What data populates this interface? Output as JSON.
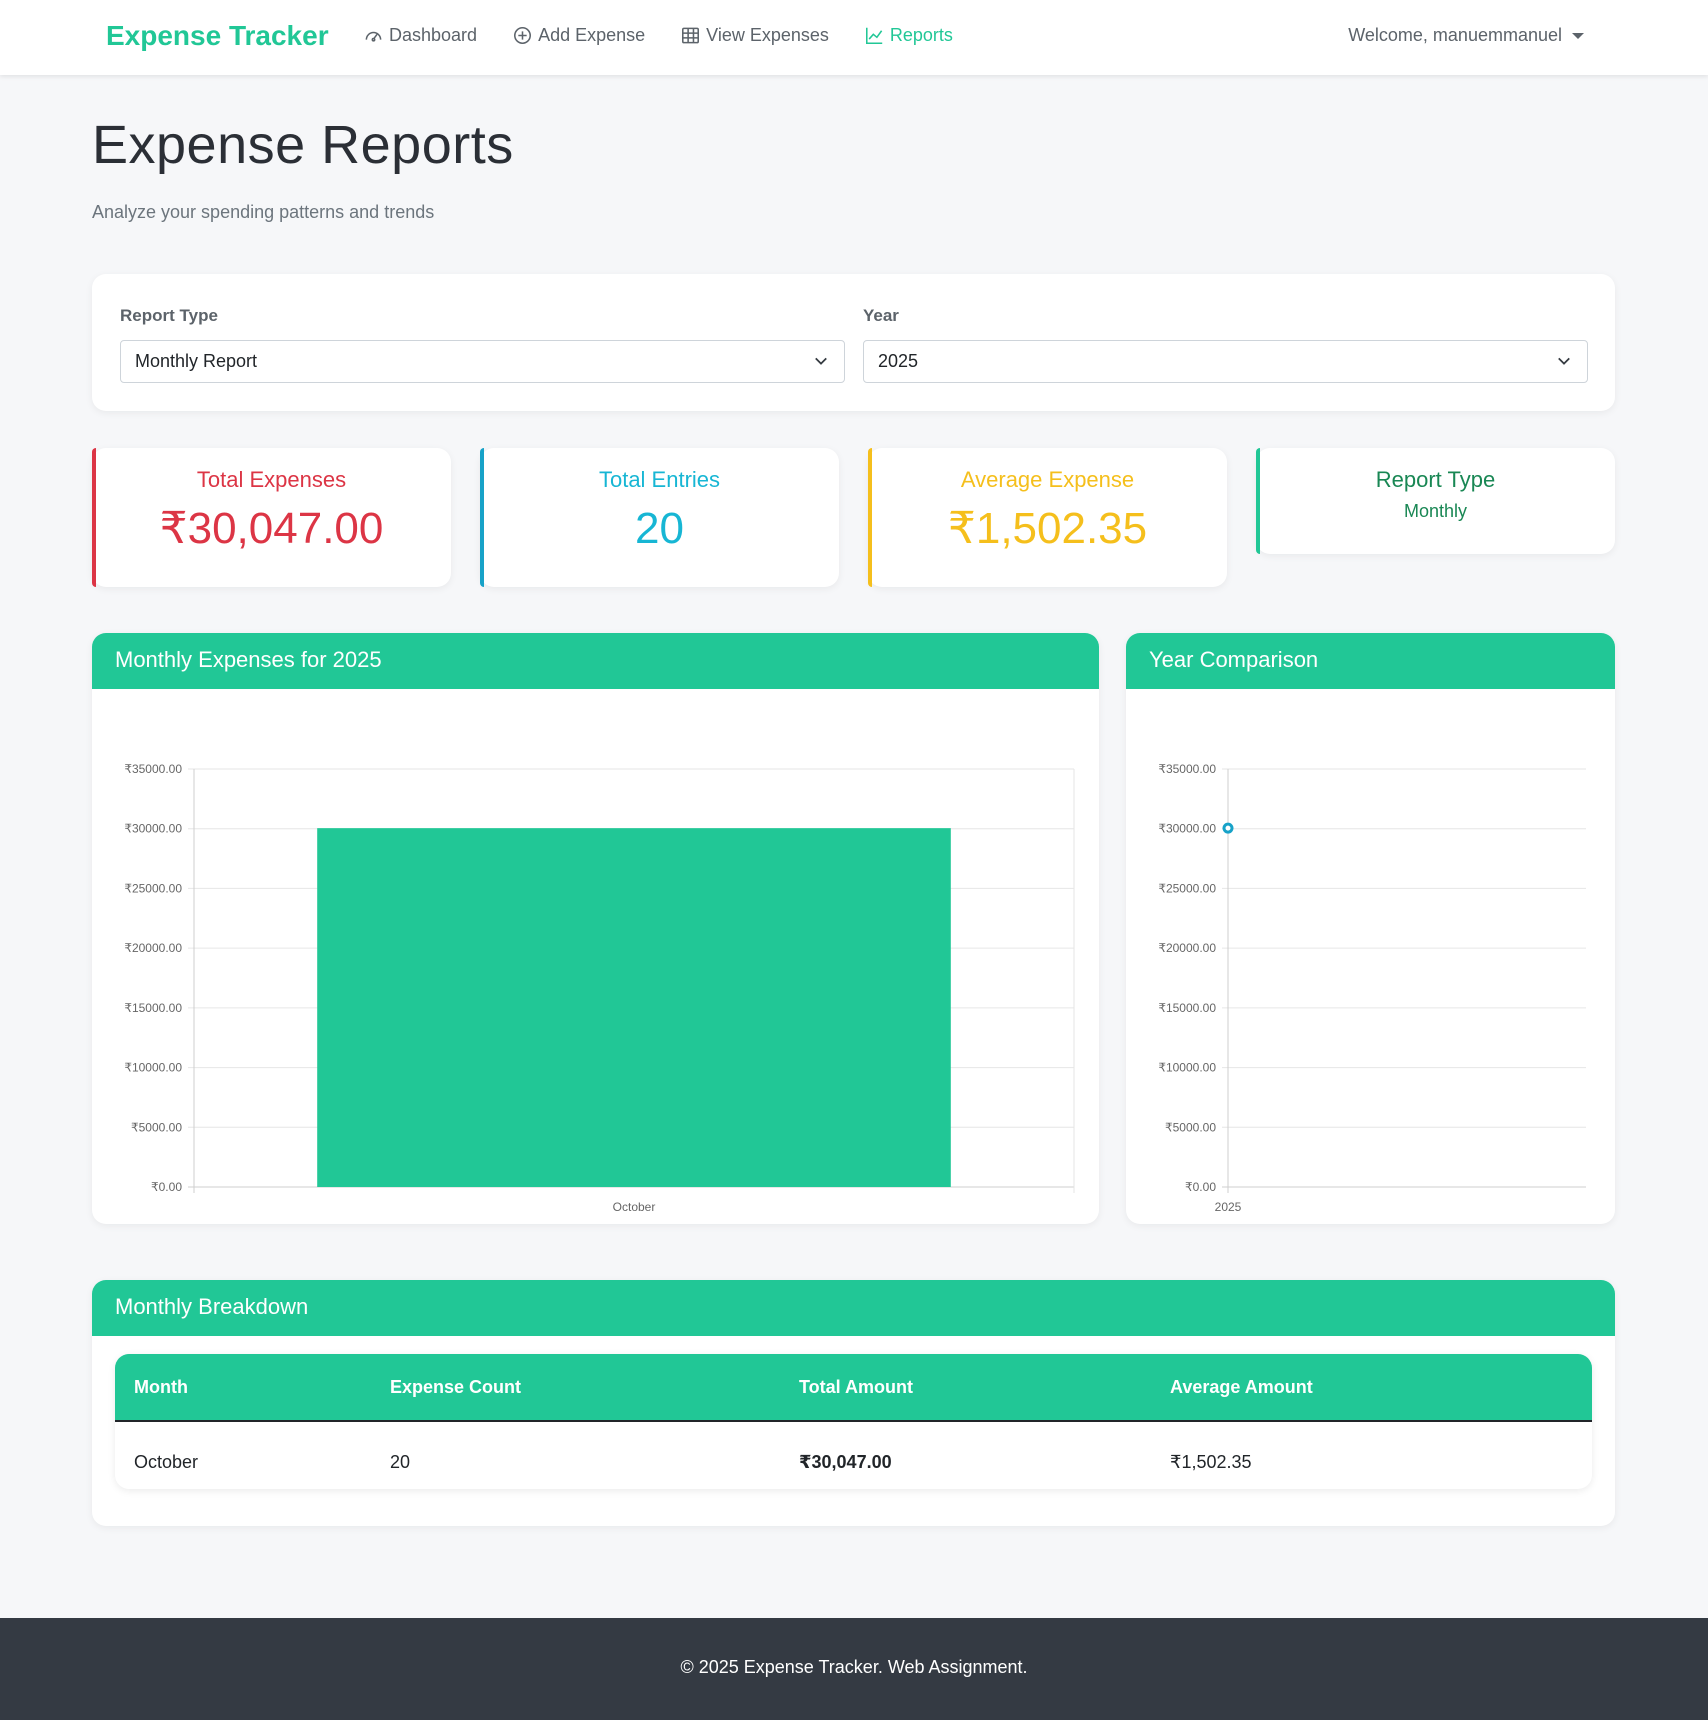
{
  "nav": {
    "brand": "Expense Tracker",
    "links": [
      {
        "label": "Dashboard",
        "icon": "speedometer-icon"
      },
      {
        "label": "Add Expense",
        "icon": "plus-circle-icon"
      },
      {
        "label": "View Expenses",
        "icon": "table-icon"
      },
      {
        "label": "Reports",
        "icon": "line-chart-icon"
      }
    ],
    "active_link": "Reports",
    "user": "Welcome, manuemmanuel"
  },
  "page": {
    "title": "Expense Reports",
    "subtitle": "Analyze your spending patterns and trends"
  },
  "filters": {
    "report_type_label": "Report Type",
    "report_type_value": "Monthly Report",
    "year_label": "Year",
    "year_value": "2025"
  },
  "stats": [
    {
      "label": "Total Expenses",
      "value": "₹30,047.00",
      "color": "#dc3545"
    },
    {
      "label": "Total Entries",
      "value": "20",
      "color": "#17a2c8"
    },
    {
      "label": "Average Expense",
      "value": "₹1,502.35",
      "color": "#f5bf1c"
    },
    {
      "label": "Report Type",
      "value": "Monthly",
      "color": "#198754"
    }
  ],
  "monthly_chart": {
    "title": "Monthly Expenses for 2025"
  },
  "year_chart": {
    "title": "Year Comparison"
  },
  "chart_data": [
    {
      "type": "bar",
      "title": "Monthly Expenses for 2025",
      "categories": [
        "October"
      ],
      "values": [
        30047
      ],
      "ylim": [
        0,
        35000
      ],
      "yticks": [
        "₹0.00",
        "₹5000.00",
        "₹10000.00",
        "₹15000.00",
        "₹20000.00",
        "₹25000.00",
        "₹30000.00",
        "₹35000.00"
      ],
      "grid": true,
      "color": "#21c796"
    },
    {
      "type": "line",
      "title": "Year Comparison",
      "categories": [
        "2025"
      ],
      "values": [
        30047
      ],
      "ylim": [
        0,
        35000
      ],
      "yticks": [
        "₹0.00",
        "₹5000.00",
        "₹10000.00",
        "₹15000.00",
        "₹20000.00",
        "₹25000.00",
        "₹30000.00",
        "₹35000.00"
      ],
      "grid": true,
      "color": "#17a2c8"
    }
  ],
  "breakdown": {
    "title": "Monthly Breakdown",
    "columns": [
      "Month",
      "Expense Count",
      "Total Amount",
      "Average Amount"
    ],
    "rows": [
      [
        "October",
        "20",
        "₹30,047.00",
        "₹1,502.35"
      ]
    ]
  },
  "footer": "© 2025 Expense Tracker. Web Assignment."
}
